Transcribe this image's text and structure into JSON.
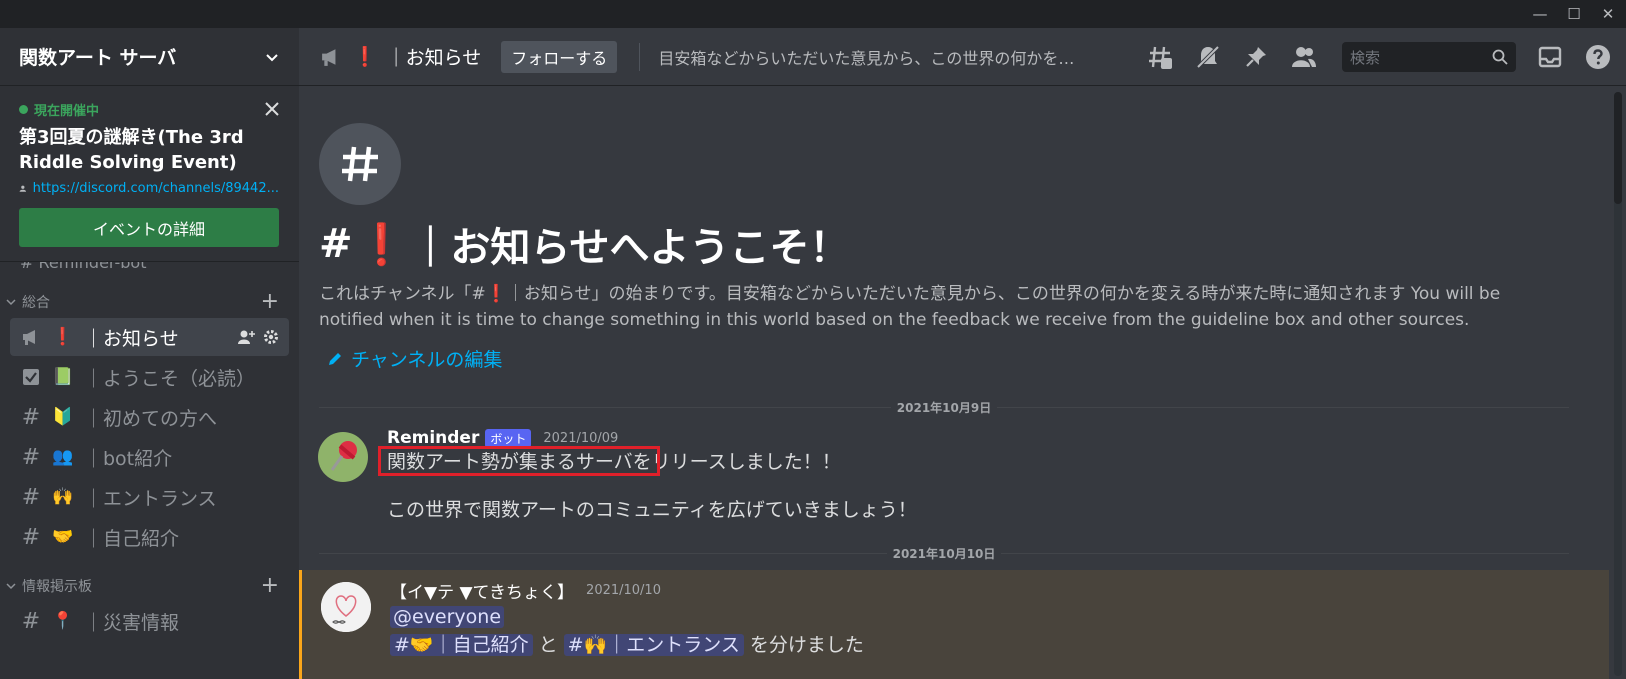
{
  "window": {
    "minimize": "—",
    "maximize": "☐",
    "close": "✕"
  },
  "server": {
    "name": "関数アート サーバ"
  },
  "event": {
    "status": "現在開催中",
    "title": "第3回夏の謎解き(The 3rd Riddle Solving Event)",
    "link": "https://discord.com/channels/89442...",
    "button": "イベントの詳細"
  },
  "sidebar": {
    "cut_channel": "Reminder-bot",
    "categories": [
      {
        "name": "総合",
        "channels": [
          {
            "icon": "megaphone-icon",
            "emoji": "❗",
            "label": "｜お知らせ",
            "active": true
          },
          {
            "icon": "rules-checkbox-icon",
            "emoji": "📗",
            "label": "｜ようこそ（必読）"
          },
          {
            "icon": "hash-icon",
            "emoji": "🔰",
            "label": "｜初めての方へ"
          },
          {
            "icon": "hash-icon",
            "emoji": "👥",
            "label": "｜bot紹介"
          },
          {
            "icon": "hash-icon",
            "emoji": "🙌",
            "label": "｜エントランス"
          },
          {
            "icon": "hash-icon",
            "emoji": "🤝",
            "label": "｜自己紹介"
          }
        ]
      },
      {
        "name": "情報掲示板",
        "channels": [
          {
            "icon": "hash-icon",
            "emoji": "📍",
            "label": "｜災害情報"
          }
        ]
      }
    ]
  },
  "topbar": {
    "channel_emoji": "❗",
    "channel_name": "｜お知らせ",
    "follow": "フォローする",
    "topic": "目安箱などからいただいた意見から、この世界の何かを…",
    "search_placeholder": "検索"
  },
  "welcome": {
    "prefix": "#",
    "emoji": "❗",
    "title": "｜お知らせへようこそ！",
    "description": "これはチャンネル「#❗｜お知らせ」の始まりです。目安箱などからいただいた意見から、この世界の何かを変える時が来た時に通知されます You will be notified when it is time to change something in this world based on the feedback we receive from the guideline box and other sources.",
    "edit": "チャンネルの編集"
  },
  "messages": {
    "date1": "2021年10月9日",
    "m1": {
      "author": "Reminder",
      "bot_tag": "ボット",
      "timestamp": "2021/10/09",
      "line1": "関数アート勢が集まるサーバをリリースしました！！",
      "line2": "この世界で関数アートのコミュニティを広げていきましょう！"
    },
    "date2": "2021年10月10日",
    "m2": {
      "author": "【イ▼テ ▼てきちょく】",
      "timestamp": "2021/10/10",
      "mention": "@everyone",
      "ch1": "#🤝｜自己紹介",
      "and": " と ",
      "ch2": "#🙌｜エントランス",
      "tail": " を分けました"
    }
  },
  "colors": {
    "accent": "#5865f2",
    "highlight": "#e0202a",
    "event_green": "#2d7d46",
    "link": "#00b0f4"
  }
}
